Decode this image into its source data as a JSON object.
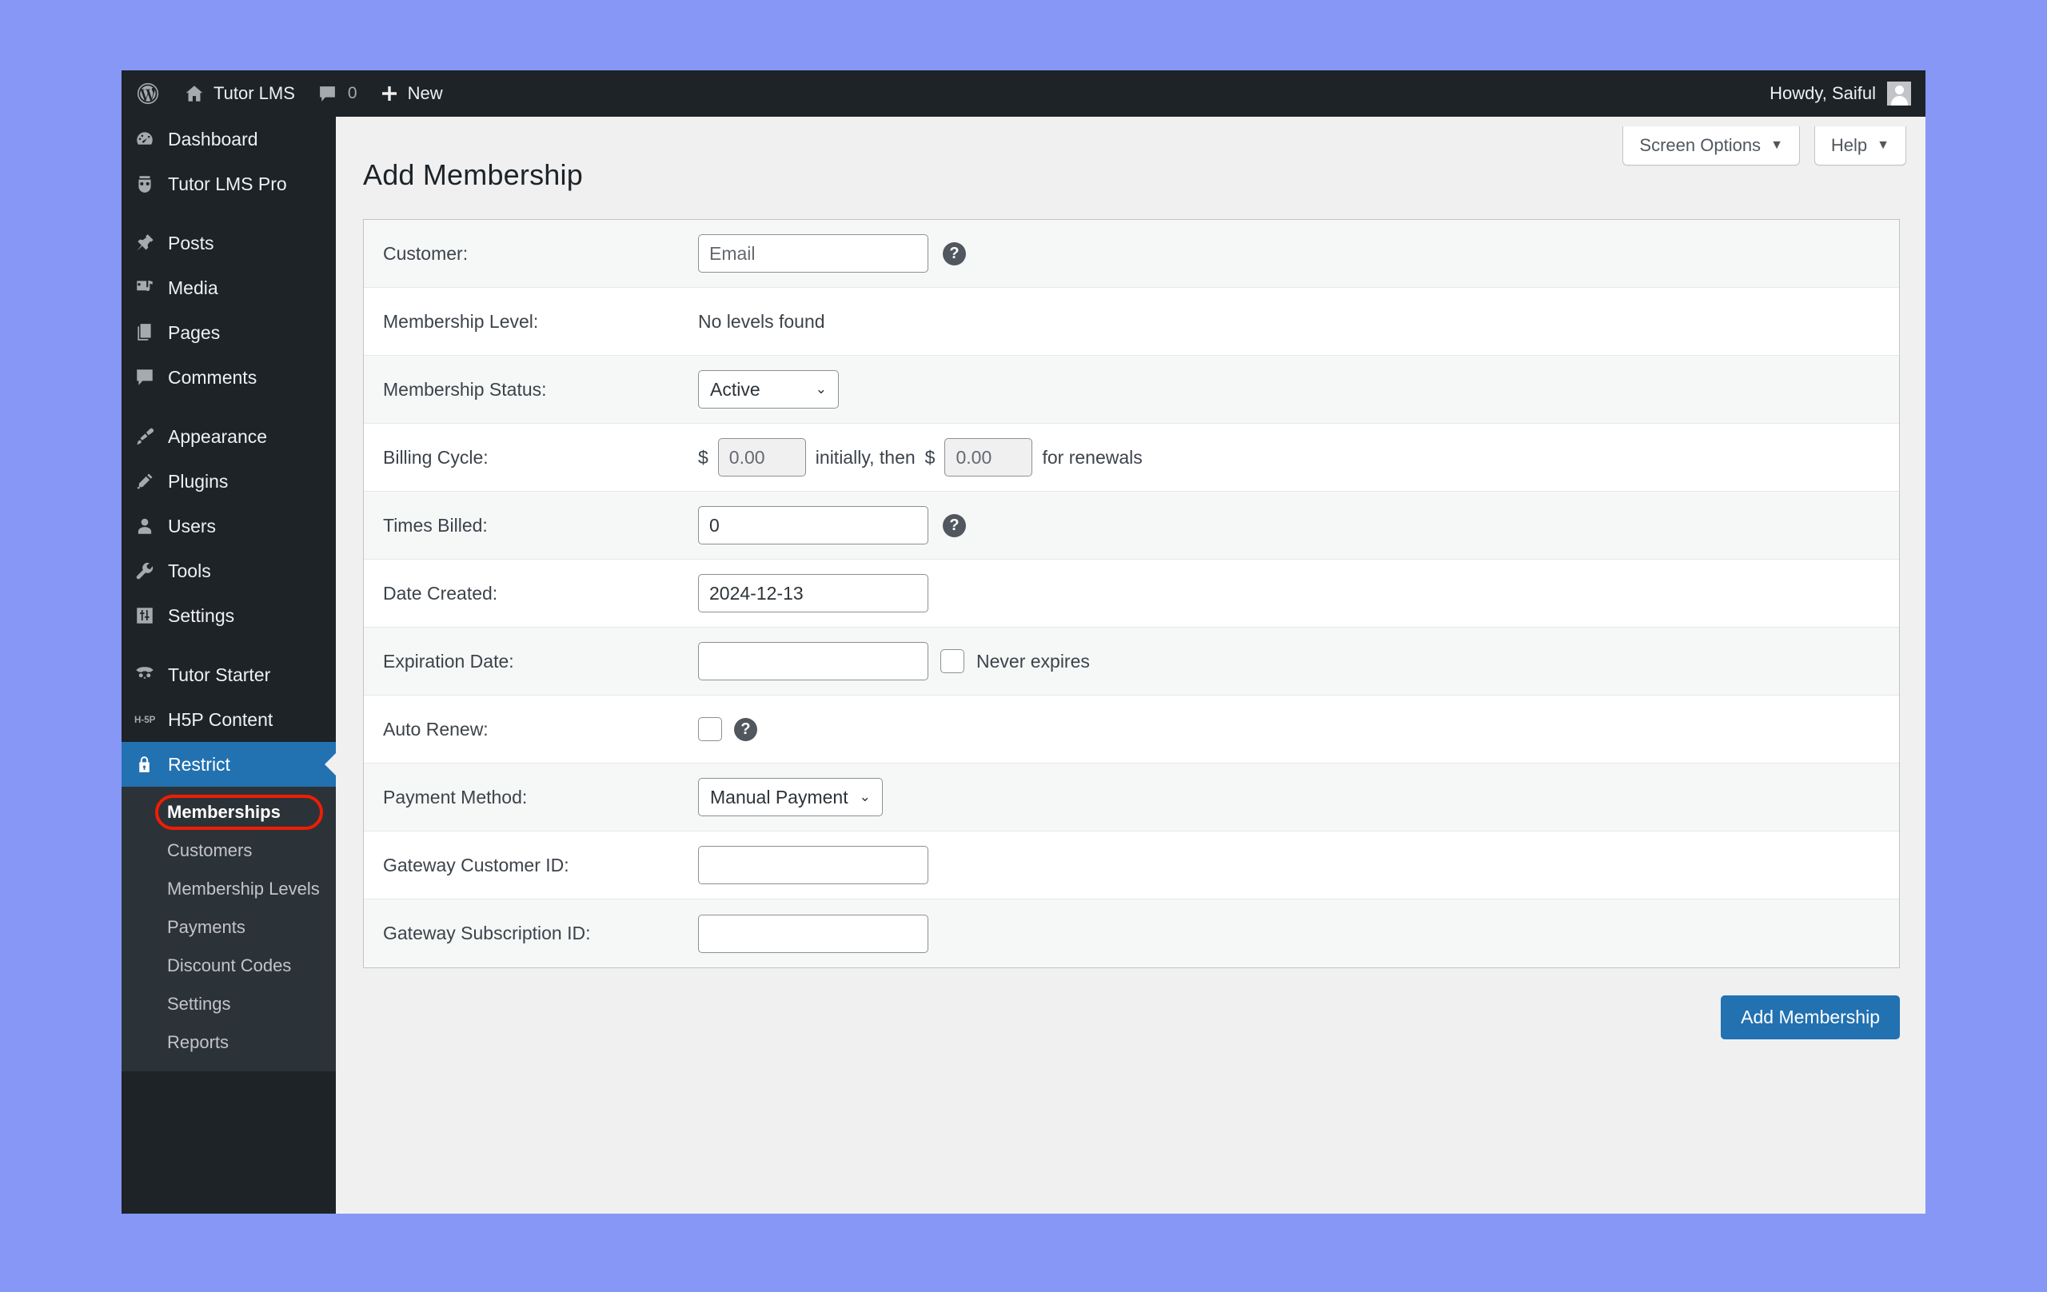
{
  "colors": {
    "desktop_bg": "#8697f5",
    "admin_bar_bg": "#1d2327",
    "sidebar_bg": "#1d2327",
    "submenu_bg": "#2c3338",
    "accent_blue": "#2271b1",
    "highlight_ring": "#f01d05",
    "content_bg": "#f0f0f1"
  },
  "adminbar": {
    "site_name": "Tutor LMS",
    "comment_count": "0",
    "new_label": "New",
    "howdy": "Howdy, Saiful"
  },
  "sidebar": {
    "items": [
      {
        "label": "Dashboard",
        "icon": "dashboard-icon"
      },
      {
        "label": "Tutor LMS Pro",
        "icon": "tutor-owl-icon"
      },
      {
        "label": "Posts",
        "icon": "pin-icon"
      },
      {
        "label": "Media",
        "icon": "media-icon"
      },
      {
        "label": "Pages",
        "icon": "pages-icon"
      },
      {
        "label": "Comments",
        "icon": "comment-icon"
      },
      {
        "label": "Appearance",
        "icon": "brush-icon"
      },
      {
        "label": "Plugins",
        "icon": "plug-icon"
      },
      {
        "label": "Users",
        "icon": "user-icon"
      },
      {
        "label": "Tools",
        "icon": "wrench-icon"
      },
      {
        "label": "Settings",
        "icon": "sliders-icon"
      },
      {
        "label": "Tutor Starter",
        "icon": "owl-icon"
      },
      {
        "label": "H5P Content",
        "icon": "h5p-icon"
      },
      {
        "label": "Restrict",
        "icon": "lock-icon"
      }
    ],
    "submenu": [
      {
        "label": "Memberships"
      },
      {
        "label": "Customers"
      },
      {
        "label": "Membership Levels"
      },
      {
        "label": "Payments"
      },
      {
        "label": "Discount Codes"
      },
      {
        "label": "Settings"
      },
      {
        "label": "Reports"
      }
    ]
  },
  "screen_meta": {
    "screen_options": "Screen Options",
    "help": "Help",
    "caret": "▼"
  },
  "page": {
    "title": "Add Membership"
  },
  "form": {
    "rows": {
      "customer": {
        "label": "Customer:",
        "placeholder": "Email",
        "value": ""
      },
      "membership_level": {
        "label": "Membership Level:",
        "value": "No levels found"
      },
      "membership_status": {
        "label": "Membership Status:",
        "value": "Active"
      },
      "billing_cycle": {
        "label": "Billing Cycle:",
        "currency": "$",
        "initial_amount": "0.00",
        "mid_text": "initially, then",
        "renewal_amount": "0.00",
        "suffix_text": "for renewals"
      },
      "times_billed": {
        "label": "Times Billed:",
        "value": "0"
      },
      "date_created": {
        "label": "Date Created:",
        "value": "2024-12-13"
      },
      "expiration_date": {
        "label": "Expiration Date:",
        "value": "",
        "never_expires_label": "Never expires"
      },
      "auto_renew": {
        "label": "Auto Renew:"
      },
      "payment_method": {
        "label": "Payment Method:",
        "value": "Manual Payment"
      },
      "gateway_customer_id": {
        "label": "Gateway Customer ID:",
        "value": ""
      },
      "gateway_subscription_id": {
        "label": "Gateway Subscription ID:",
        "value": ""
      }
    },
    "submit_label": "Add Membership",
    "select_caret": "⌄"
  }
}
